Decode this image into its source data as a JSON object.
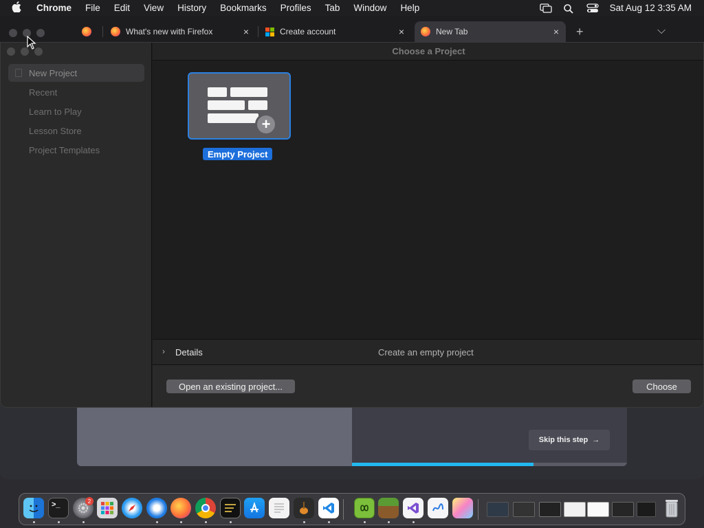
{
  "menubar": {
    "app_name": "Chrome",
    "items": [
      "File",
      "Edit",
      "View",
      "History",
      "Bookmarks",
      "Profiles",
      "Tab",
      "Window",
      "Help"
    ],
    "clock": "Sat Aug 12  3:35 AM"
  },
  "tabs": [
    {
      "title": "",
      "icon": "firefox-icon"
    },
    {
      "title": "What's new with Firefox",
      "icon": "firefox-icon",
      "close": "×"
    },
    {
      "title": "Create account",
      "icon": "microsoft-icon",
      "close": "×"
    },
    {
      "title": "New Tab",
      "icon": "firefox-icon",
      "close": "×",
      "active": true
    }
  ],
  "tabstrip": {
    "new_tab": "+",
    "tab_list": "⌵"
  },
  "dialog": {
    "header_title": "Choose a Project",
    "sidebar": [
      "New Project",
      "Recent",
      "Learn to Play",
      "Lesson Store",
      "Project Templates"
    ],
    "template": {
      "label": "Empty Project",
      "plus": "+"
    },
    "details": {
      "chevron": "›",
      "label": "Details",
      "description": "Create an empty project"
    },
    "buttons": {
      "open_existing": "Open an existing project...",
      "choose": "Choose"
    }
  },
  "onboarding": {
    "skip_label": "Skip this step",
    "skip_arrow": "→",
    "progress_fraction": 0.66
  },
  "dock": {
    "badge_count": "2",
    "apps": [
      "finder-icon",
      "terminal-icon",
      "system-settings-icon",
      "launchpad-icon",
      "safari-icon",
      "safari-preview-icon",
      "firefox-icon",
      "chrome-icon",
      "console-icon",
      "app-store-icon",
      "textedit-icon",
      "garageband-icon",
      "vscode-icon",
      "swift-playgrounds-icon",
      "minecraft-icon",
      "visual-studio-icon",
      "freeform-icon",
      "pages-icon"
    ],
    "trash": "trash-icon"
  },
  "colors": {
    "accent": "#1d6fdb",
    "progress": "#22b8f0"
  }
}
